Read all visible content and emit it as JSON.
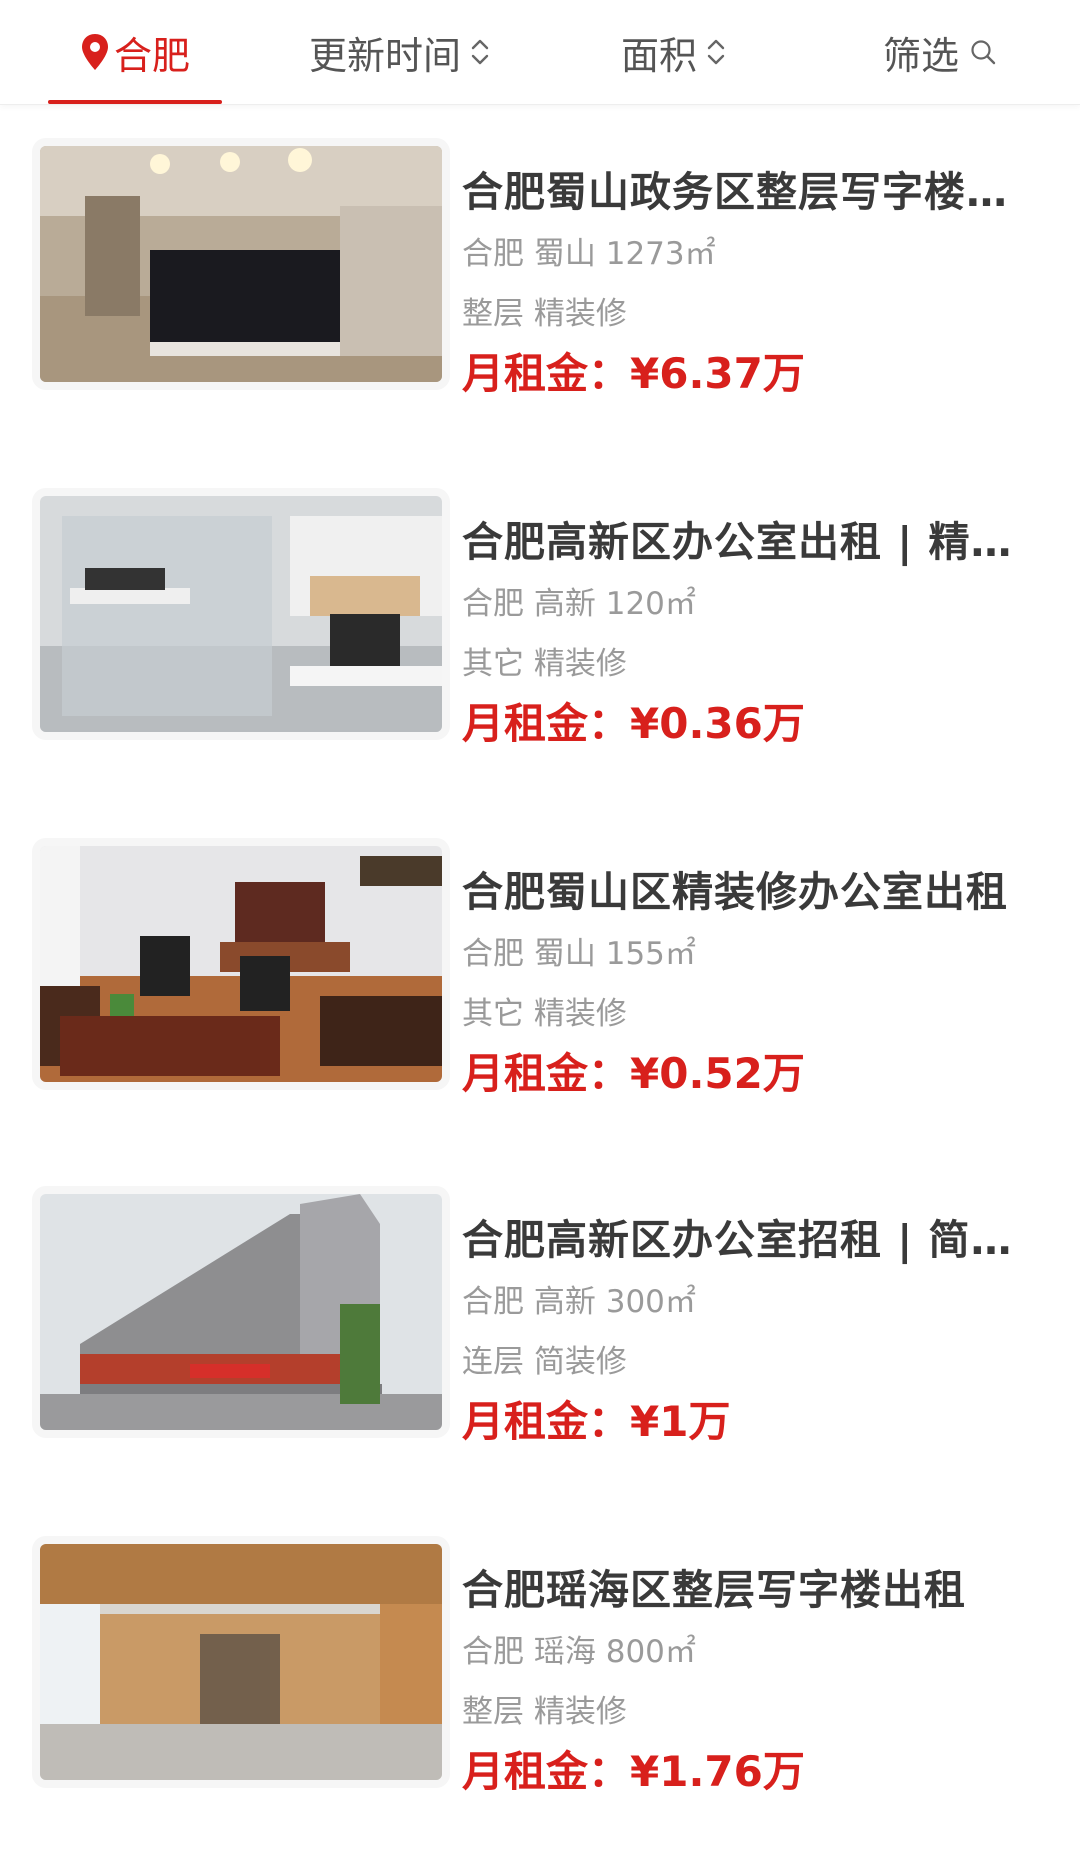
{
  "header": {
    "city": "合肥",
    "update_label": "更新时间",
    "area_label": "面积",
    "filter_label": "筛选",
    "accent_color": "#d8201c"
  },
  "listings": [
    {
      "title": "合肥蜀山政务区整层写字楼出租",
      "city": "合肥",
      "district": "蜀山",
      "area": "1273㎡",
      "floor_type": "整层",
      "decoration": "精装修",
      "price_label": "月租金：",
      "price": "¥6.37万",
      "image": "lobby-reception-photo"
    },
    {
      "title": "合肥高新区办公室出租 | 精装修",
      "city": "合肥",
      "district": "高新",
      "area": "120㎡",
      "floor_type": "其它",
      "decoration": "精装修",
      "price_label": "月租金：",
      "price": "¥0.36万",
      "image": "office-meeting-room-photo"
    },
    {
      "title": "合肥蜀山区精装修办公室出租",
      "city": "合肥",
      "district": "蜀山",
      "area": "155㎡",
      "floor_type": "其它",
      "decoration": "精装修",
      "price_label": "月租金：",
      "price": "¥0.52万",
      "image": "executive-office-photo"
    },
    {
      "title": "合肥高新区办公室招租 | 简装修",
      "city": "合肥",
      "district": "高新",
      "area": "300㎡",
      "floor_type": "连层",
      "decoration": "简装修",
      "price_label": "月租金：",
      "price": "¥1万",
      "image": "building-exterior-photo"
    },
    {
      "title": "合肥瑶海区整层写字楼出租",
      "city": "合肥",
      "district": "瑶海",
      "area": "800㎡",
      "floor_type": "整层",
      "decoration": "精装修",
      "price_label": "月租金：",
      "price": "¥1.76万",
      "image": "open-floor-interior-photo"
    }
  ]
}
